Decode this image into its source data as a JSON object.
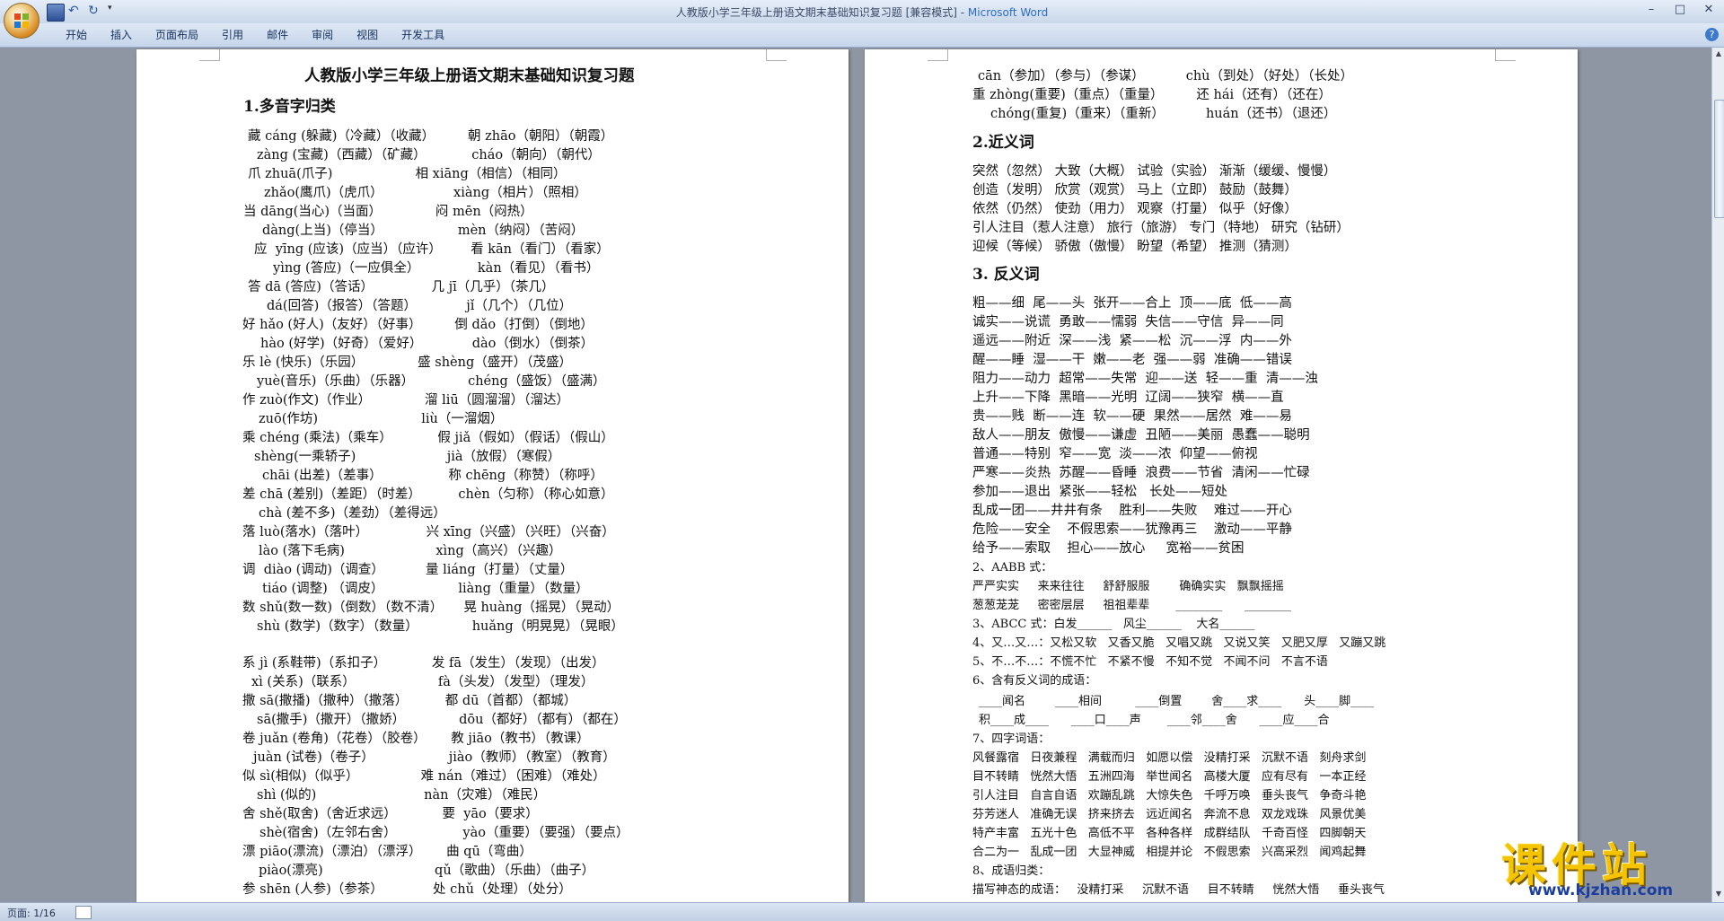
{
  "window": {
    "title": "人教版小学三年级上册语文期末基础知识复习题 [兼容模式] - ",
    "app": "Microsoft Word",
    "controls": [
      "–",
      "□",
      "✕"
    ]
  },
  "ribbon": {
    "tabs": [
      "开始",
      "插入",
      "页面布局",
      "引用",
      "邮件",
      "审阅",
      "视图",
      "开发工具"
    ]
  },
  "status": {
    "page": "页面: 1/16"
  },
  "watermark": {
    "text": "课件站",
    "url": "www.kjzhan.com"
  },
  "page1": {
    "lines": [
      "人教版小学三年级上册语文期末基础知识复习题",
      "1.多音字归类",
      "藏 cáng (躲藏)（冷藏）（收藏）        朝 zhāo（朝阳）（朝霞）",
      "zàng (宝藏)（西藏）（矿藏）           cháo（朝向）（朝代）",
      "爪 zhuā(爪子)                    相 xiāng（相信）（相同）",
      "zhǎo(鹰爪)（虎爪）                 xiàng（相片）（照相）",
      "当 dāng(当心)（当面）             闷 mēn（闷热）",
      "dàng(上当)（停当）                  mèn（纳闷）（苦闷）",
      "应  yīng (应该)（应当）（应许）       看 kān（看门）（看家）",
      "yìng (答应)（一应俱全）              kàn（看见）（看书）",
      "答 dā (答应)（答话）              几 jī（几乎）（茶几）",
      "dá(回答)（报答）（答题）            jǐ（几个）（几位）",
      "好 hǎo (好人)（友好）（好事）        倒 dǎo（打倒）（倒地）",
      "hào (好学)（好奇）（爱好）            dào（倒水）（倒茶）",
      "乐 lè (快乐)（乐园）             盛 shèng（盛开）（茂盛）",
      "yuè(音乐)（乐曲）（乐器）             chéng（盛饭）（盛满）",
      "作 zuò(作文)（作业）             溜 liū（圆溜溜）（溜达）",
      "zuō(作坊)                         liù（一溜烟）",
      "乘 chéng (乘法)（乘车）           假 jiǎ（假如）（假话）（假山）",
      "shèng(一乘轿子)                      jià（放假）（寒假）",
      "chāi (出差)（差事）                称 chēng（称赞）（称呼）",
      "差 chā (差别)（差距）（时差）         chèn（匀称）（称心如意）",
      "chà (差不多)（差劲）（差得远）",
      "落 luò(落水)（落叶）              兴 xīng（兴盛）（兴旺）（兴奋）",
      "lào (落下毛病)                      xìng（高兴）（兴趣）",
      "调  diào (调动)（调查）          量 liáng（打量）（丈量）",
      "tiáo (调整) （调皮）                  liàng（重量）（数量）",
      "数 shǔ(数一数)（倒数）（数不清）     晃 huàng（摇晃）（晃动）",
      "shù (数学)（数字）（数量）             huǎng（明晃晃）（晃眼）",
      "系 jì (系鞋带)（系扣子）           发 fā（发生）（发现）（出发）",
      "xì (关系)（联系）                    fà（头发）（发型）（理发）",
      "撒 sā(撒播)（撒种）（撒落）         都 dū（首都）（都城）",
      "sā(撒手)（撒开）（撒娇）             dōu（都好）（都有）（都在）",
      "卷 juǎn (卷角)（花卷）（胶卷）      教 jiāo（教书）（教课）",
      "juàn (试卷)（卷子）                  jiào（教师）（教室）（教育）",
      "似 sì(相似)（似乎）               难 nán（难过）（困难）（难处）",
      "shì (似的)                          nàn（灾难）（难民）",
      "舍 shě(取舍)（舍近求远）           要  yāo（要求）",
      "shè(宿舍)（左邻右舍）                yào（重要）（要强）（要点）",
      "漂 piāo(漂流)（漂泊）（漂浮）      曲 qū（弯曲）",
      "piào(漂亮)                           qǔ（歌曲）（乐曲）（曲子）",
      "参 shēn (人参)（参茶）            处 chǔ（处理）（处分）"
    ]
  },
  "page2": {
    "lines": [
      "cān（参加）（参与）（参谋）          chù（到处）（好处）（长处）",
      "重 zhòng(重要)（重点）（重量）        还 hái（还有）（还在）",
      "chóng(重复)（重来）（重新）          huán（还书）（退还）",
      "2.近义词",
      "突然（忽然） 大致（大概） 试验（实验） 渐渐（缓缓、慢慢）",
      "创造（发明） 欣赏（观赏） 马上（立即） 鼓励（鼓舞）",
      "依然（仍然） 使劲（用力） 观察（打量） 似乎（好像）",
      "引人注目（惹人注意） 旅行（旅游） 专门（特地） 研究（钻研）",
      "迎候（等候） 骄傲（傲慢） 盼望（希望） 推测（猜测）",
      "3. 反义词",
      "粗——细  尾——头  张开——合上  顶——底  低——高",
      "诚实——说谎  勇敢——懦弱  失信——守信  异——同",
      "遥远——附近  深——浅  紧——松  沉——浮  内——外",
      "醒——睡  湿——干  嫩——老  强——弱  准确——错误",
      "阻力——动力  超常——失常  迎——送  轻——重  清——浊",
      "上升——下降  黑暗——光明  辽阔——狭窄  横——直",
      "贵——贱  断——连  软——硬  果然——居然  难——易",
      "敌人——朋友  傲慢——谦虚  丑陋——美丽  愚蠢——聪明",
      "普通——特别  窄——宽  淡——浓  仰望——俯视",
      "严寒——炎热  苏醒——昏睡  浪费——节省  清闲——忙碌",
      "参加——退出  紧张——轻松   长处——短处",
      "乱成一团——井井有条    胜利——失败    难过——开心",
      "危险——安全    不假思索——犹豫再三    激动——平静",
      "给予——索取    担心——放心     宽裕——贫困",
      "2、AABB 式：",
      "严严实实     来来往往     舒舒服服        确确实实   飘飘摇摇",
      "葱葱茏茏     密密层层     祖祖辈辈       ________      ________",
      "3、ABCC 式：白发______   风尘______    大名______",
      "4、又…又…：又松又软   又香又脆   又唱又跳   又说又笑   又肥又厚   又蹦又跳",
      "5、不…不…：不慌不忙   不紧不慢   不知不觉   不闻不问   不言不语",
      "6、含有反义词的成语：",
      "____闻名        ____相间         ____倒置        舍____求____      头____脚____",
      "积____成____      ____口____声       ____邻____舍      ____应____合",
      "7、四字词语：",
      "风餐露宿   日夜兼程   满载而归   如愿以偿   没精打采   沉默不语   刻舟求剑",
      "目不转睛   恍然大悟   五洲四海   举世闻名   高楼大厦   应有尽有   一本正经",
      "引人注目   自言自语   欢蹦乱跳   大惊失色   千呼万唤   垂头丧气   争奇斗艳",
      "芬芳迷人   准确无误   挤来挤去   远近闻名   奔流不息   双龙戏珠   风景优美",
      "特产丰富   五光十色   高低不平   各种各样   成群结队   千奇百怪   四脚朝天",
      "合二为一   乱成一团   大显神威   相提并论   不假思索   兴高采烈   闻鸡起舞",
      "8、成语归类：",
      "描写神态的成语：   没精打采     沉默不语     目不转睛     恍然大悟     垂头丧气"
    ]
  }
}
